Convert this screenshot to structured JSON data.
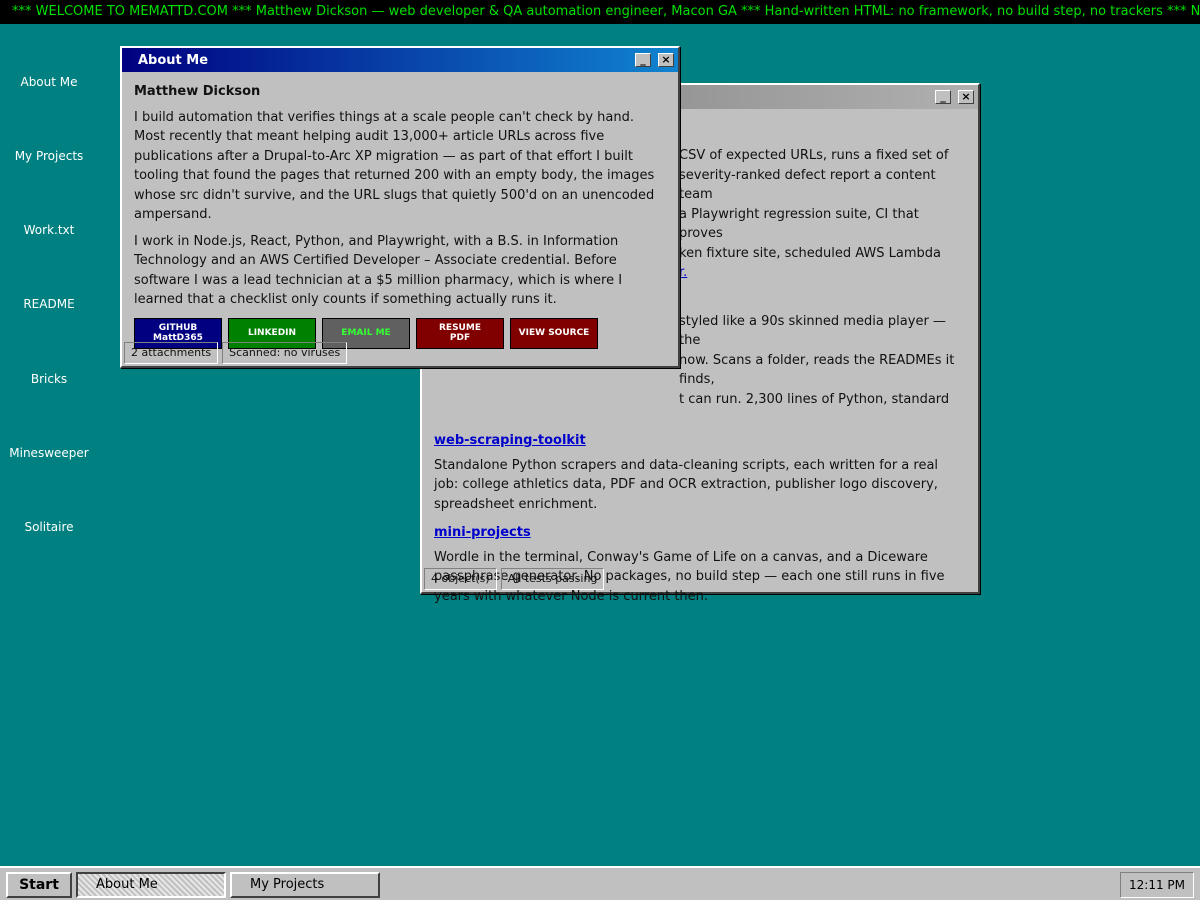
{
  "marquee": "*** WELCOME TO MEMATTD.COM *** Matthew Dickson — web developer & QA automation engineer, Macon GA *** Hand-written HTML: no framework, no build step, no trackers *** NEW: Bricks, Minesweeper a",
  "desktop_icons": [
    {
      "label": "About Me"
    },
    {
      "label": "My Projects"
    },
    {
      "label": "Work.txt"
    },
    {
      "label": "README"
    },
    {
      "label": "Bricks"
    },
    {
      "label": "Minesweeper"
    },
    {
      "label": "Solitaire"
    }
  ],
  "about_window": {
    "title": "About Me",
    "minimize_label": "_",
    "close_label": "×",
    "name": "Matthew Dickson",
    "paragraphs": [
      "I build automation that verifies things at a scale people can't check by hand. Most recently that meant helping audit 13,000+ article URLs across five publications after a Drupal-to-Arc XP migration — as part of that effort I built tooling that found the pages that returned 200 with an empty body, the images whose src didn't survive, and the URL slugs that quietly 500'd on an unencoded ampersand.",
      "I work in Node.js, React, Python, and Playwright, with a B.S. in Information Technology and an AWS Certified Developer – Associate credential. Before software I was a lead technician at a $5 million pharmacy, which is where I learned that a checklist only counts if something actually runs it."
    ],
    "buttons": [
      {
        "label": "GITHUB\nMattD365",
        "bg": "#000080",
        "fg": "#ffffff"
      },
      {
        "label": "LINKEDIN",
        "bg": "#008000",
        "fg": "#ffffff"
      },
      {
        "label": "EMAIL ME",
        "bg": "#606060",
        "fg": "#33ff33"
      },
      {
        "label": "RESUME\nPDF",
        "bg": "#800000",
        "fg": "#ffffff"
      },
      {
        "label": "VIEW SOURCE",
        "bg": "#800000",
        "fg": "#ffffff"
      }
    ],
    "status": [
      "2 attachments",
      "Scanned: no viruses"
    ]
  },
  "projects_window": {
    "minimize_label": "_",
    "close_label": "×",
    "partial_lines_1": [
      "CSV of expected URLs, runs a fixed set of",
      "severity-ranked defect report a content team",
      "a Playwright regression suite, CI that proves",
      "ken fixture site, scheduled AWS Lambda"
    ],
    "partial_link_tail": "r.",
    "partial_lines_2": [
      "styled like a 90s skinned media player — the",
      "now. Scans a folder, reads the READMEs it finds,",
      "t can run. 2,300 lines of Python, standard"
    ],
    "projects": [
      {
        "name": "web-scraping-toolkit",
        "desc": "Standalone Python scrapers and data-cleaning scripts, each written for a real job: college athletics data, PDF and OCR extraction, publisher logo discovery, spreadsheet enrichment."
      },
      {
        "name": "mini-projects",
        "desc": "Wordle in the terminal, Conway's Game of Life on a canvas, and a Diceware passphrase generator. No packages, no build step — each one still runs in five years with whatever Node is current then."
      }
    ],
    "status": [
      "4 object(s)",
      "All tests passing"
    ]
  },
  "taskbar": {
    "start_label": "Start",
    "tasks": [
      "About Me",
      "My Projects"
    ],
    "clock": "12:11 PM"
  }
}
